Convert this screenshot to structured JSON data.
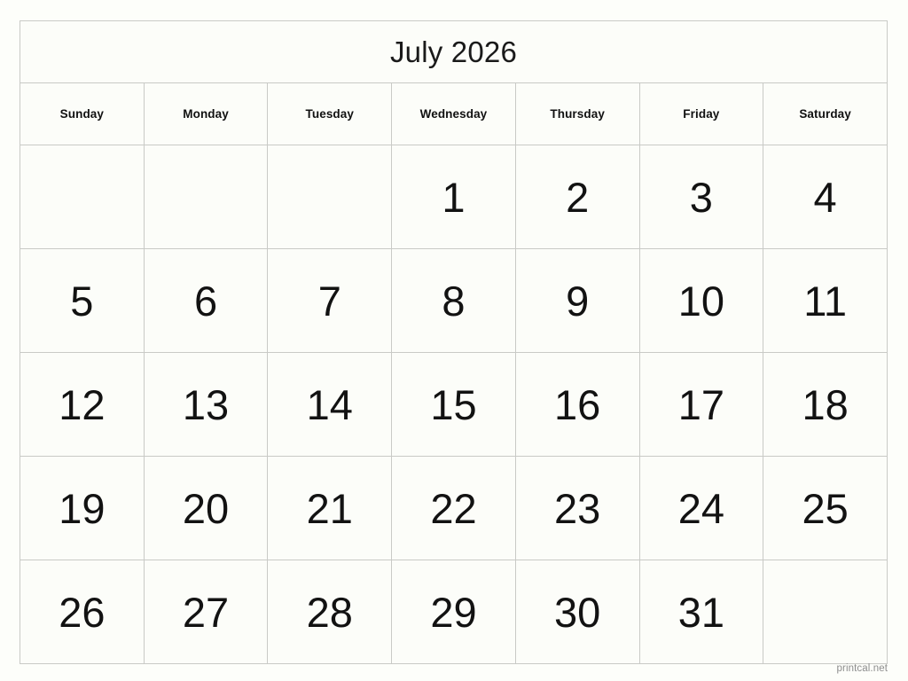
{
  "calendar": {
    "title": "July 2026",
    "weekdays": [
      "Sunday",
      "Monday",
      "Tuesday",
      "Wednesday",
      "Thursday",
      "Friday",
      "Saturday"
    ],
    "weeks": [
      [
        "",
        "",
        "",
        "1",
        "2",
        "3",
        "4"
      ],
      [
        "5",
        "6",
        "7",
        "8",
        "9",
        "10",
        "11"
      ],
      [
        "12",
        "13",
        "14",
        "15",
        "16",
        "17",
        "18"
      ],
      [
        "19",
        "20",
        "21",
        "22",
        "23",
        "24",
        "25"
      ],
      [
        "26",
        "27",
        "28",
        "29",
        "30",
        "31",
        ""
      ]
    ]
  },
  "footer": {
    "watermark": "printcal.net"
  },
  "colors": {
    "page_background": "#fdfefa",
    "cell_background": "#fcfdf9",
    "border": "#c9cac6",
    "title_text": "#1a1a1a",
    "weekday_text": "#111111",
    "date_text": "#121212",
    "watermark_text": "#8d8d8d"
  }
}
